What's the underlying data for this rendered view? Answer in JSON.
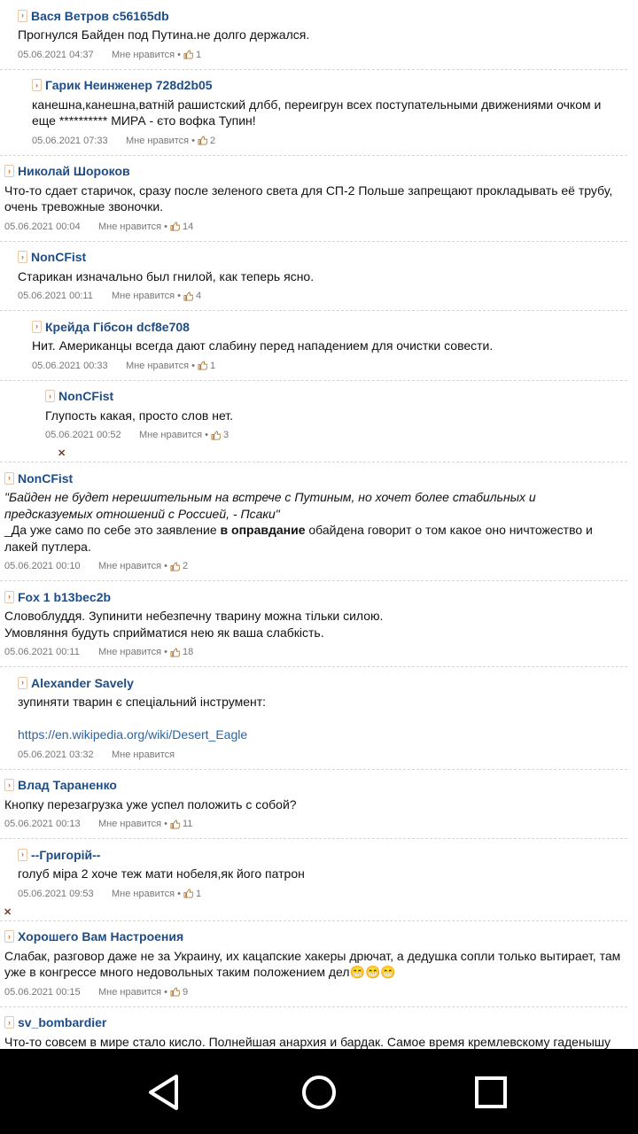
{
  "like_label": "Мне нравится",
  "comments": [
    {
      "author": "Вася Ветров c56165db",
      "text": [
        "Прогнулся Байден под Путина.не долго держался."
      ],
      "date": "05.06.2021 04:37",
      "likes": "1"
    },
    {
      "author": "Гарик Неинженер 728d2b05",
      "text": [
        "канешна,канешна,ватній рашистский длбб, переигрун всех поступательными движениями очком и еще ********** МИРА - єто вофка Тупин!"
      ],
      "date": "05.06.2021 07:33",
      "likes": "2"
    },
    {
      "author": "Николай Шороков",
      "text": [
        "Что-то сдает старичок, сразу после зеленого света для СП-2 Польше запрещают прокладывать её трубу, очень тревожные звоночки."
      ],
      "date": "05.06.2021 00:04",
      "likes": "14"
    },
    {
      "author": "NonCFist",
      "text": [
        "Старикан изначально был гнилой, как теперь ясно."
      ],
      "date": "05.06.2021 00:11",
      "likes": "4"
    },
    {
      "author": "Крейда Гібсон dcf8e708",
      "text": [
        "Нит. Американцы всегда дают слабину перед нападением для очистки совести."
      ],
      "date": "05.06.2021 00:33",
      "likes": "1"
    },
    {
      "author": "NonCFist",
      "text": [
        "Глупость какая, просто слов нет."
      ],
      "date": "05.06.2021 00:52",
      "likes": "3"
    },
    {
      "author": "NonCFist",
      "quote": "\"Байден не будет нерешительным на встрече с Путиным, но хочет более стабильных и предсказуемых отношений с Россией, - Псаки\"",
      "text_pre": "_Да уже само по себе это заявление ",
      "text_bold": "в оправдание",
      "text_post": " обайдена говорит о том какое оно ничтожество и лакей путлера.",
      "date": "05.06.2021 00:10",
      "likes": "2"
    },
    {
      "author": "Fox 1 b13bec2b",
      "text": [
        "Словоблуддя. Зупинити небезпечну тварину можна тільки силою.",
        "Умовляння будуть сприйматися нею як ваша слабкість."
      ],
      "date": "05.06.2021 00:11",
      "likes": "18"
    },
    {
      "author": "Alexander Savely",
      "text": [
        "зупиняти тварин є спеціальний інструмент:"
      ],
      "link": "https://en.wikipedia.org/wiki/Desert_Eagle",
      "date": "05.06.2021 03:32",
      "likes": ""
    },
    {
      "author": "Влад Тараненко",
      "text": [
        "Кнопку перезагрузка уже успел положить с собой?"
      ],
      "date": "05.06.2021 00:13",
      "likes": "11"
    },
    {
      "author": "--Григорій--",
      "text": [
        "голуб міра 2 хоче теж мати нобеля,як його патрон"
      ],
      "date": "05.06.2021 09:53",
      "likes": "1"
    },
    {
      "author": "Хорошего Вам Настроения",
      "text": [
        "Слабак, разговор даже не за Украину, их кацапские хакеры дрючат, а дедушка сопли только вытирает, там уже в конгрессе много недовольных таким положением дел😁😁😁"
      ],
      "date": "05.06.2021 00:15",
      "likes": "9"
    },
    {
      "author": "sv_bombardier",
      "text": [
        "Что-то совсем в мире стало кисло. Полнейшая анархия и бардак. Самое время кремлевскому гаденышу что-то подленькое замутить."
      ],
      "date": "",
      "likes": ""
    }
  ],
  "nav": {
    "back": "back-triangle-icon",
    "home": "home-circle-icon",
    "recents": "recents-square-icon"
  }
}
